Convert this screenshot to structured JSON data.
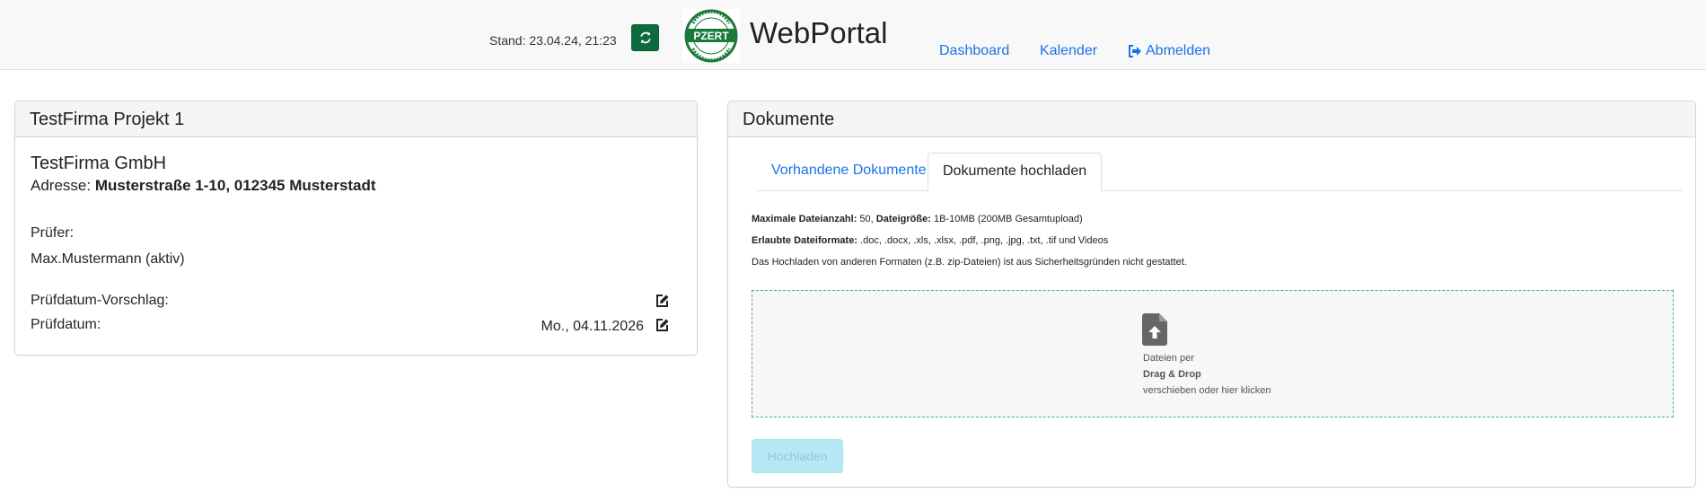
{
  "header": {
    "stand": "Stand: 23.04.24, 21:23",
    "brand": "WebPortal",
    "logo_text": "PZERT",
    "logo_ring_text": "prüfen & zertifizieren · www.pzert.de",
    "refresh_icon": "refresh-icon",
    "nav": {
      "dashboard": "Dashboard",
      "kalender": "Kalender",
      "abmelden": "Abmelden"
    }
  },
  "project": {
    "title": "TestFirma Projekt 1",
    "company": "TestFirma GmbH",
    "address_label": "Adresse: ",
    "address_value": "Musterstraße 1-10, 012345 Musterstadt",
    "pruefer_label": "Prüfer:",
    "pruefer_value": "Max.Mustermann (aktiv)",
    "vorschlag_label": "Prüfdatum-Vorschlag:",
    "datum_label": "Prüfdatum:",
    "datum_value": "Mo., 04.11.2026"
  },
  "documents": {
    "title": "Dokumente",
    "tabs": [
      "Vorhandene Dokumente",
      "Dokumente hochladen"
    ],
    "active_tab": "Dokumente hochladen",
    "info": {
      "max_count_label": "Maximale Dateianzahl:",
      "max_count_value": " 50, ",
      "size_label": "Dateigröße:",
      "size_value": " 1B-10MB (200MB Gesamtupload)",
      "formats_label": "Erlaubte Dateiformate:",
      "formats_value": " .doc, .docx, .xls, .xlsx, .pdf, .png, .jpg, .txt, .tif und Videos",
      "note": "Das Hochladen von anderen Formaten (z.B. zip-Dateien) ist aus Sicherheitsgründen nicht gestattet."
    },
    "dropzone": {
      "line1": "Dateien per",
      "line2": "Drag & Drop",
      "line3": "verschieben oder hier klicken"
    },
    "upload_button": "Hochladen"
  },
  "colors": {
    "link": "#1a73e8",
    "brand_green": "#0e6b3d",
    "upload_disabled": "#b6e9f5"
  }
}
